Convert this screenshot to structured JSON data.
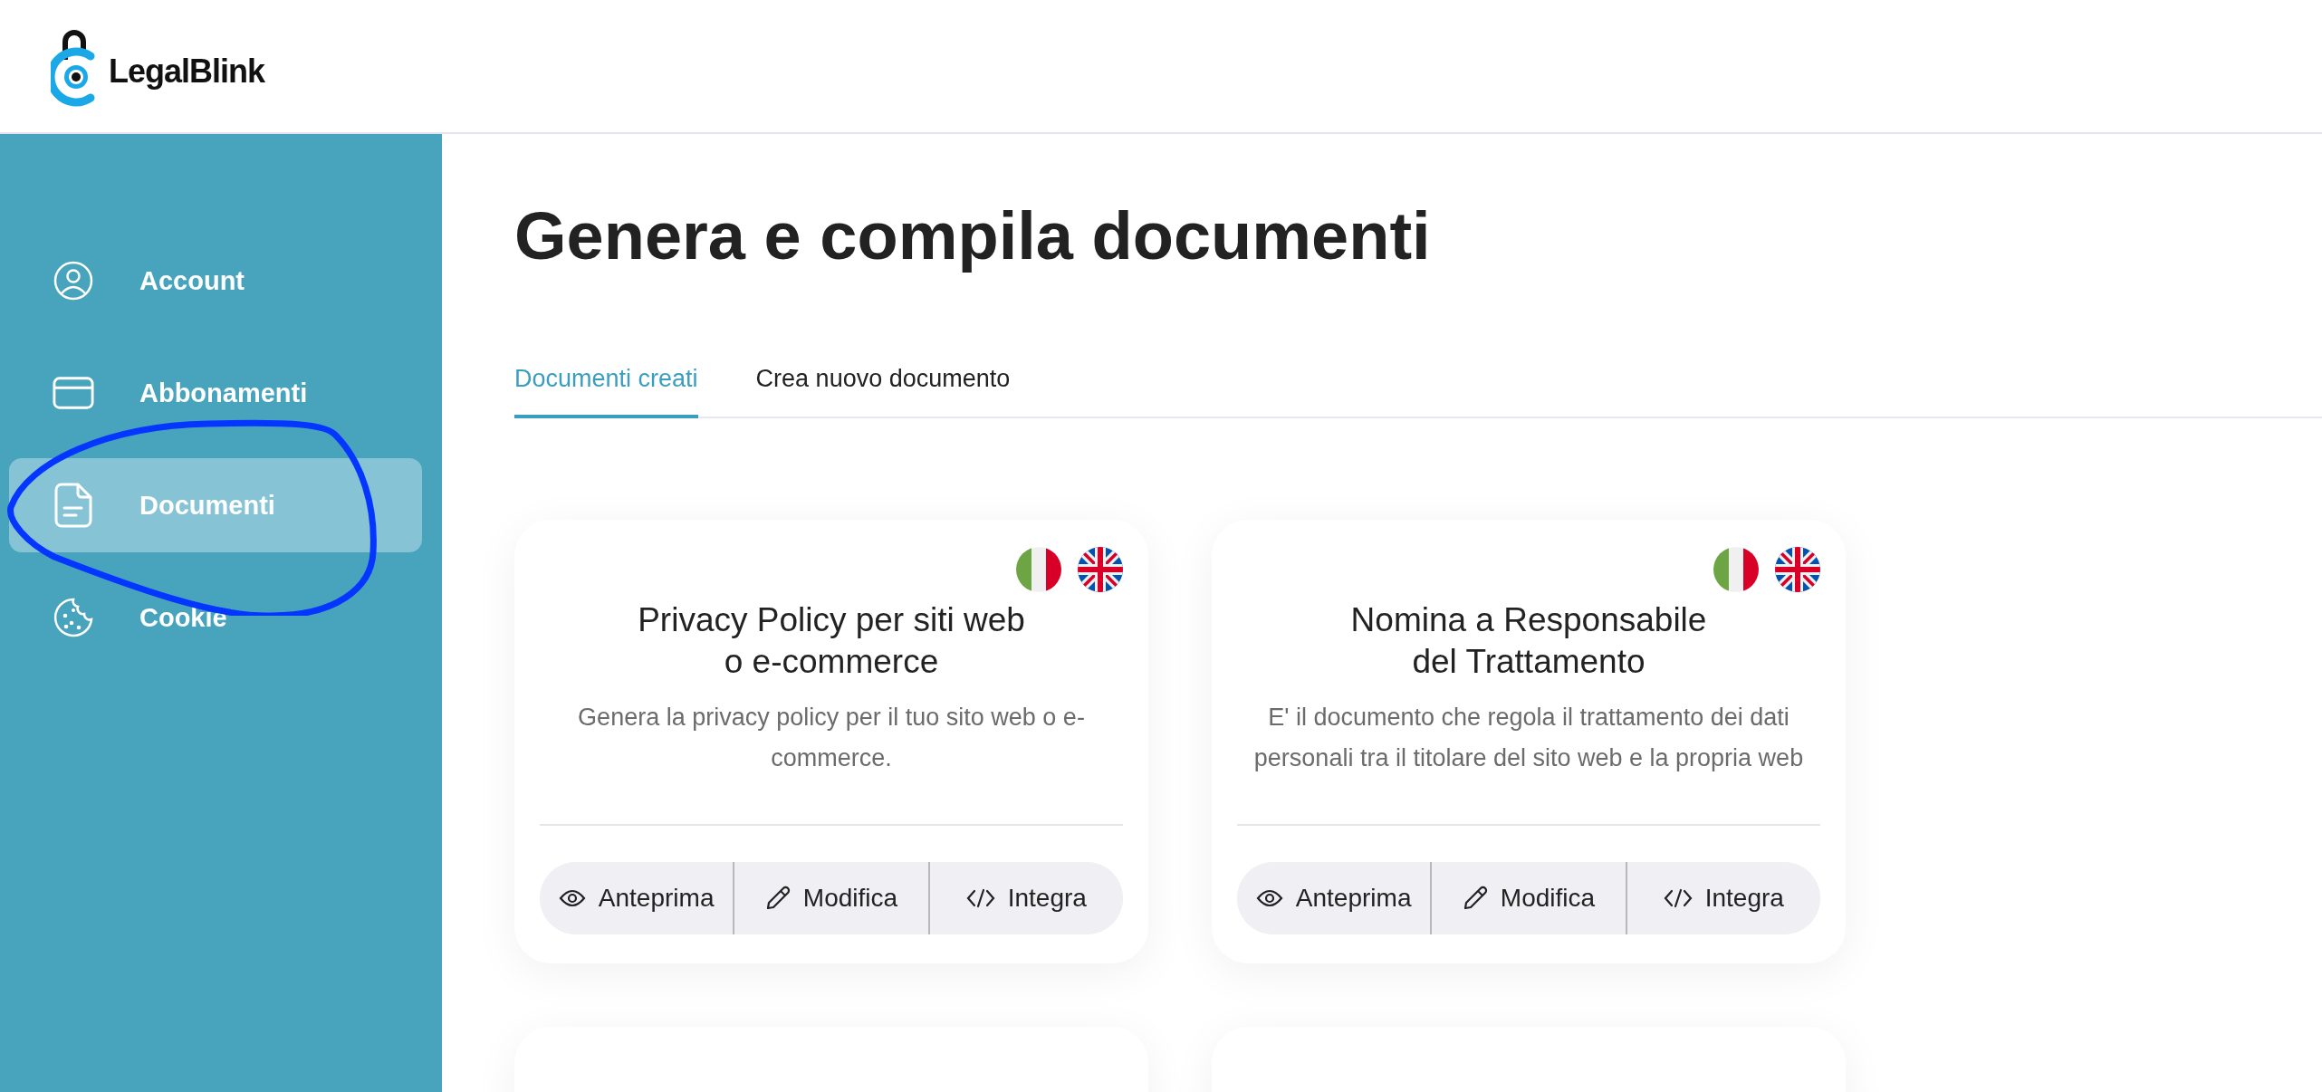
{
  "logo": {
    "text": "LegalBlink"
  },
  "sidebar": {
    "items": [
      {
        "label": "Account",
        "kind": "user",
        "selected": false
      },
      {
        "label": "Abbonamenti",
        "kind": "card",
        "selected": false
      },
      {
        "label": "Documenti",
        "kind": "document",
        "selected": true
      },
      {
        "label": "Cookie",
        "kind": "cookie",
        "selected": false
      }
    ]
  },
  "page_title": "Genera e compila documenti",
  "tabs": [
    {
      "label": "Documenti creati",
      "selected": true
    },
    {
      "label": "Crea nuovo documento",
      "selected": false
    }
  ],
  "cards": [
    {
      "title": "Privacy Policy per siti web\no e-commerce",
      "description": "Genera la privacy policy per il tuo sito web o e-commerce.",
      "actions": [
        {
          "label": "Anteprima",
          "kind": "preview"
        },
        {
          "label": "Modifica",
          "kind": "edit"
        },
        {
          "label": "Integra",
          "kind": "embed"
        }
      ]
    },
    {
      "title": "Nomina a Responsabile\ndel Trattamento",
      "description": "E' il documento che regola il trattamento dei dati personali tra il titolare del sito web e la propria web",
      "actions": [
        {
          "label": "Anteprima",
          "kind": "preview"
        },
        {
          "label": "Modifica",
          "kind": "edit"
        },
        {
          "label": "Integra",
          "kind": "embed"
        }
      ]
    }
  ]
}
